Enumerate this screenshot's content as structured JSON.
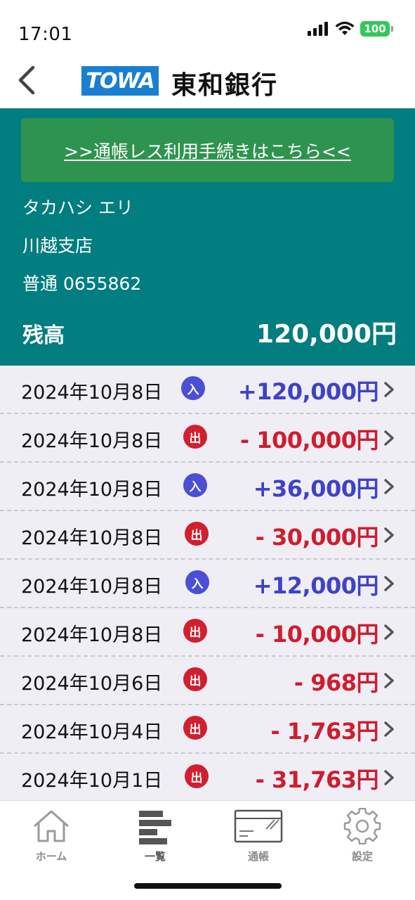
{
  "status_bar": {
    "time": "17:01",
    "battery": "100",
    "icons": [
      "signal-icon",
      "wifi-icon",
      "battery-icon"
    ]
  },
  "header": {
    "logo_text": "TOWA",
    "bank_name": "東和銀行",
    "back_icon": "chevron-left-icon",
    "logo_color": "#1a7fd1"
  },
  "account": {
    "passbookless_link": ">>通帳レス利用手続きはこちら<<",
    "holder_name": "タカハシ エリ",
    "branch": "川越支店",
    "account_number": "普通 0655862",
    "balance_label": "残高",
    "balance": "120,000円",
    "panel_color": "#027d80",
    "button_color": "#2f9350"
  },
  "transactions": [
    {
      "date": "2024年10月8日",
      "type": "入",
      "amount": "+120,000円"
    },
    {
      "date": "2024年10月8日",
      "type": "出",
      "amount": "- 100,000円"
    },
    {
      "date": "2024年10月8日",
      "type": "入",
      "amount": "+36,000円"
    },
    {
      "date": "2024年10月8日",
      "type": "出",
      "amount": "- 30,000円"
    },
    {
      "date": "2024年10月8日",
      "type": "入",
      "amount": "+12,000円"
    },
    {
      "date": "2024年10月8日",
      "type": "出",
      "amount": "- 10,000円"
    },
    {
      "date": "2024年10月6日",
      "type": "出",
      "amount": "- 968円"
    },
    {
      "date": "2024年10月4日",
      "type": "出",
      "amount": "- 1,763円"
    },
    {
      "date": "2024年10月1日",
      "type": "出",
      "amount": "- 31,763円"
    }
  ],
  "colors": {
    "deposit": "#3f42c8",
    "withdrawal": "#cf1d2e"
  },
  "tab_bar": {
    "tabs": [
      {
        "label": "ホーム",
        "icon": "home-icon"
      },
      {
        "label": "一覧",
        "icon": "list-icon",
        "active": true
      },
      {
        "label": "通帳",
        "icon": "passbook-icon"
      },
      {
        "label": "設定",
        "icon": "gear-icon"
      }
    ]
  }
}
